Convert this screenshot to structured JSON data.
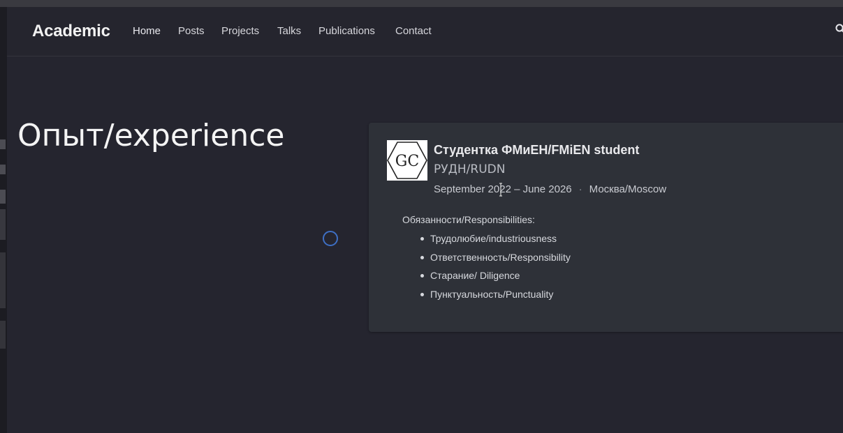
{
  "navbar": {
    "brand": "Academic",
    "links": [
      "Home",
      "Posts",
      "Projects",
      "Talks",
      "Publications",
      "Contact"
    ],
    "search_icon": "search-icon"
  },
  "page": {
    "title": "Опыт/experience"
  },
  "experience": {
    "logo_text": "GC",
    "title": "Студентка ФМиЕН/FMiEN student",
    "organization": "РУДН/RUDN",
    "dates": "September 2022 – June 2026",
    "separator": "·",
    "location": "Москва/Moscow",
    "responsibilities_heading": "Обязанности/Responsibilities:",
    "responsibilities": [
      "Трудолюбие/industriousness",
      "Ответственность/Responsibility",
      "Старание/ Diligence",
      "Пунктуальность/Punctuality"
    ]
  },
  "colors": {
    "background": "#25252f",
    "card": "#2e3138",
    "accent_ring": "#3e6fc4"
  }
}
